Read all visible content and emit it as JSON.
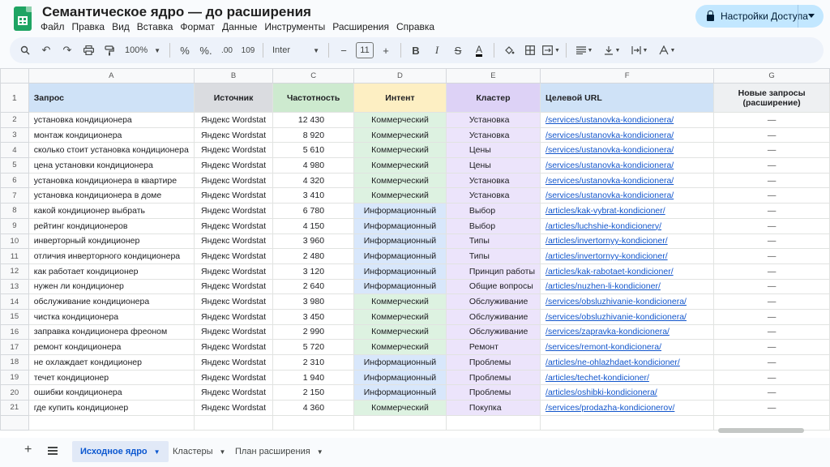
{
  "app": {
    "title": "Семантическое ядро — до расширения",
    "menu": [
      "Файл",
      "Правка",
      "Вид",
      "Вставка",
      "Формат",
      "Данные",
      "Инструменты",
      "Расширения",
      "Справка"
    ],
    "share_label": "Настройки Доступа"
  },
  "toolbar": {
    "zoom": "100%",
    "percent": "%",
    "dec_decrease": "%.",
    "dec_increase": ".00",
    "number_format": "109",
    "font": "Inter",
    "font_size": "11",
    "minus": "−",
    "plus": "+",
    "bold": "B",
    "italic": "I",
    "strike": "S",
    "text_color": "A"
  },
  "sheet": {
    "columns": [
      "A",
      "B",
      "C",
      "D",
      "E",
      "F",
      "G"
    ],
    "headers": {
      "query": "Запрос",
      "source": "Источник",
      "frequency": "Частотность",
      "intent": "Интент",
      "cluster": "Кластер",
      "url": "Целевой URL",
      "new": "Новые запросы (расширение)"
    },
    "rows": [
      {
        "n": "2",
        "query": "установка кондиционера",
        "source": "Яндекс Wordstat",
        "freq": "12 430",
        "intent": "Коммерческий",
        "intent_type": "com",
        "cluster": "Установка",
        "url": "/services/ustanovka-kondicionera/",
        "new": "—"
      },
      {
        "n": "3",
        "query": "монтаж кондиционера",
        "source": "Яндекс Wordstat",
        "freq": "8 920",
        "intent": "Коммерческий",
        "intent_type": "com",
        "cluster": "Установка",
        "url": "/services/ustanovka-kondicionera/",
        "new": "—"
      },
      {
        "n": "4",
        "query": "сколько стоит установка кондиционера",
        "source": "Яндекс Wordstat",
        "freq": "5 610",
        "intent": "Коммерческий",
        "intent_type": "com",
        "cluster": "Цены",
        "url": "/services/ustanovka-kondicionera/",
        "new": "—"
      },
      {
        "n": "5",
        "query": "цена установки кондиционера",
        "source": "Яндекс Wordstat",
        "freq": "4 980",
        "intent": "Коммерческий",
        "intent_type": "com",
        "cluster": "Цены",
        "url": "/services/ustanovka-kondicionera/",
        "new": "—"
      },
      {
        "n": "6",
        "query": "установка кондиционера в квартире",
        "source": "Яндекс Wordstat",
        "freq": "4 320",
        "intent": "Коммерческий",
        "intent_type": "com",
        "cluster": "Установка",
        "url": "/services/ustanovka-kondicionera/",
        "new": "—"
      },
      {
        "n": "7",
        "query": "установка кондиционера в доме",
        "source": "Яндекс Wordstat",
        "freq": "3 410",
        "intent": "Коммерческий",
        "intent_type": "com",
        "cluster": "Установка",
        "url": "/services/ustanovka-kondicionera/",
        "new": "—"
      },
      {
        "n": "8",
        "query": "какой кондиционер выбрать",
        "source": "Яндекс Wordstat",
        "freq": "6 780",
        "intent": "Информационный",
        "intent_type": "inf",
        "cluster": "Выбор",
        "url": "/articles/kak-vybrat-kondicioner/",
        "new": "—"
      },
      {
        "n": "9",
        "query": "рейтинг кондиционеров",
        "source": "Яндекс Wordstat",
        "freq": "4 150",
        "intent": "Информационный",
        "intent_type": "inf",
        "cluster": "Выбор",
        "url": "/articles/luchshie-kondicionery/",
        "new": "—"
      },
      {
        "n": "10",
        "query": "инверторный кондиционер",
        "source": "Яндекс Wordstat",
        "freq": "3 960",
        "intent": "Информационный",
        "intent_type": "inf",
        "cluster": "Типы",
        "url": "/articles/invertornyy-kondicioner/",
        "new": "—"
      },
      {
        "n": "11",
        "query": "отличия инверторного кондиционера",
        "source": "Яндекс Wordstat",
        "freq": "2 480",
        "intent": "Информационный",
        "intent_type": "inf",
        "cluster": "Типы",
        "url": "/articles/invertornyy-kondicioner/",
        "new": "—"
      },
      {
        "n": "12",
        "query": "как работает кондиционер",
        "source": "Яндекс Wordstat",
        "freq": "3 120",
        "intent": "Информационный",
        "intent_type": "inf",
        "cluster": "Принцип работы",
        "url": "/articles/kak-rabotaet-kondicioner/",
        "new": "—"
      },
      {
        "n": "13",
        "query": "нужен ли кондиционер",
        "source": "Яндекс Wordstat",
        "freq": "2 640",
        "intent": "Информационный",
        "intent_type": "inf",
        "cluster": "Общие вопросы",
        "url": "/articles/nuzhen-li-kondicioner/",
        "new": "—"
      },
      {
        "n": "14",
        "query": "обслуживание кондиционера",
        "source": "Яндекс Wordstat",
        "freq": "3 980",
        "intent": "Коммерческий",
        "intent_type": "com",
        "cluster": "Обслуживание",
        "url": "/services/obsluzhivanie-kondicionera/",
        "new": "—"
      },
      {
        "n": "15",
        "query": "чистка кондиционера",
        "source": "Яндекс Wordstat",
        "freq": "3 450",
        "intent": "Коммерческий",
        "intent_type": "com",
        "cluster": "Обслуживание",
        "url": "/services/obsluzhivanie-kondicionera/",
        "new": "—"
      },
      {
        "n": "16",
        "query": "заправка кондиционера фреоном",
        "source": "Яндекс Wordstat",
        "freq": "2 990",
        "intent": "Коммерческий",
        "intent_type": "com",
        "cluster": "Обслуживание",
        "url": "/services/zapravka-kondicionera/",
        "new": "—"
      },
      {
        "n": "17",
        "query": "ремонт кондиционера",
        "source": "Яндекс Wordstat",
        "freq": "5 720",
        "intent": "Коммерческий",
        "intent_type": "com",
        "cluster": "Ремонт",
        "url": "/services/remont-kondicionera/",
        "new": "—"
      },
      {
        "n": "18",
        "query": "не охлаждает кондиционер",
        "source": "Яндекс Wordstat",
        "freq": "2 310",
        "intent": "Информационный",
        "intent_type": "inf",
        "cluster": "Проблемы",
        "url": "/articles/ne-ohlazhdaet-kondicioner/",
        "new": "—"
      },
      {
        "n": "19",
        "query": "течет кондиционер",
        "source": "Яндекс Wordstat",
        "freq": "1 940",
        "intent": "Информационный",
        "intent_type": "inf",
        "cluster": "Проблемы",
        "url": "/articles/techet-kondicioner/",
        "new": "—"
      },
      {
        "n": "20",
        "query": "ошибки кондиционера",
        "source": "Яндекс Wordstat",
        "freq": "2 150",
        "intent": "Информационный",
        "intent_type": "inf",
        "cluster": "Проблемы",
        "url": "/articles/oshibki-kondicionera/",
        "new": "—"
      },
      {
        "n": "21",
        "query": "где купить кондиционер",
        "source": "Яндекс Wordstat",
        "freq": "4 360",
        "intent": "Коммерческий",
        "intent_type": "com",
        "cluster": "Покупка",
        "url": "/services/prodazha-kondicionerov/",
        "new": "—"
      }
    ]
  },
  "tabs": [
    {
      "label": "Исходное ядро",
      "active": true
    },
    {
      "label": "Кластеры",
      "active": false
    },
    {
      "label": "План расширения",
      "active": false
    }
  ],
  "colors": {
    "accent": "#0b57d0",
    "share_button": "#c2e7ff",
    "header_blue": "#cfe2f7",
    "header_green": "#cdeacf",
    "header_yellow": "#fdefc3",
    "header_purple": "#ddd2f6",
    "intent_commercial": "#ddf2e1",
    "intent_info": "#d8e7fb",
    "link": "#1155cc"
  },
  "icons": [
    "sheets-logo-icon",
    "lock-icon",
    "search-icon",
    "undo-icon",
    "redo-icon",
    "print-icon",
    "paint-format-icon",
    "fill-color-icon",
    "borders-icon",
    "merge-cells-icon",
    "align-icon",
    "valign-icon",
    "wrap-icon",
    "rotate-icon",
    "add-sheet-icon",
    "all-sheets-icon"
  ]
}
